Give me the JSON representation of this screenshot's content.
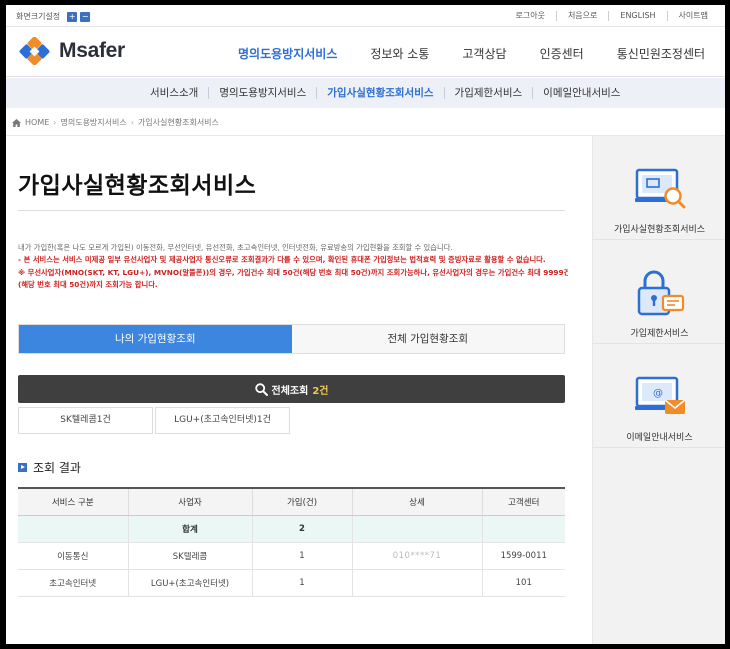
{
  "utility": {
    "font_size_label": "화면크기설정",
    "plus": "+",
    "minus": "−",
    "links": [
      "로그아웃",
      "처음으로",
      "ENGLISH",
      "사이트맵"
    ]
  },
  "header": {
    "logo_text": "Msafer",
    "nav": [
      {
        "label": "명의도용방지서비스",
        "active": true
      },
      {
        "label": "정보와 소통",
        "active": false
      },
      {
        "label": "고객상담",
        "active": false
      },
      {
        "label": "인증센터",
        "active": false
      },
      {
        "label": "통신민원조정센터",
        "active": false
      }
    ]
  },
  "subnav": [
    {
      "label": "서비스소개",
      "active": false
    },
    {
      "label": "명의도용방지서비스",
      "active": false
    },
    {
      "label": "가입사실현황조회서비스",
      "active": true
    },
    {
      "label": "가입제한서비스",
      "active": false
    },
    {
      "label": "이메일안내서비스",
      "active": false
    }
  ],
  "breadcrumb": [
    "HOME",
    "명의도용방지서비스",
    "가입사실현황조회서비스"
  ],
  "page": {
    "title": "가입사실현황조회서비스",
    "desc": [
      "내가 가입한(혹은 나도 모르게 가입된) 이동전화, 무선인터넷, 유선전화, 초고속인터넷, 인터넷전화, 유료방송의 가입현황을 조회할 수 있습니다.",
      "- 본 서비스는 서비스 미제공 일부 유선사업자 및 제공사업자 통신오류로 조회결과가 다를 수 있으며, 확인된 휴대폰 가입정보는 법적효력 및 증빙자료로 활용할 수 없습니다.",
      "※ 무선사업자(MNO(SKT, KT, LGU+), MVNO(알뜰폰))의 경우, 가입건수 최대 50건(해당 번호 최대 50건)까지 조회가능하나, 유선사업자의 경우는 가입건수 최대 9999건",
      "(해당 번호 최대 50건)까지 조회가능 합니다."
    ],
    "tabs": [
      {
        "label": "나의 가입현황조회",
        "active": true
      },
      {
        "label": "전체 가입현황조회",
        "active": false
      }
    ],
    "search_label": "전체조회",
    "search_count": "2건",
    "carriers": [
      "SK텔레콤1건",
      "LGU+(초고속인터넷)1건"
    ],
    "result_heading": "조회 결과",
    "table": {
      "headers": [
        "서비스 구분",
        "사업자",
        "가입(건)",
        "상세",
        "고객센터"
      ],
      "sum_label": "합계",
      "sum_value": "2",
      "rows": [
        [
          "이동통신",
          "SK텔레콤",
          "1",
          "010​****7​1​",
          "1599-0011"
        ],
        [
          "초고속인터넷",
          "LGU+(초고속인터넷)",
          "1",
          "",
          "101"
        ]
      ]
    }
  },
  "aside": [
    {
      "label": "가입사실현황조회서비스",
      "icon": "monitor-search-icon"
    },
    {
      "label": "가입제한서비스",
      "icon": "lock-card-icon"
    },
    {
      "label": "이메일안내서비스",
      "icon": "monitor-mail-icon"
    }
  ],
  "colors": {
    "accent": "#2d6fd2",
    "tab_active": "#3d86e0",
    "search_bar": "#3f3f3f",
    "warning": "#d11f1f",
    "icon_orange": "#f28c28"
  }
}
